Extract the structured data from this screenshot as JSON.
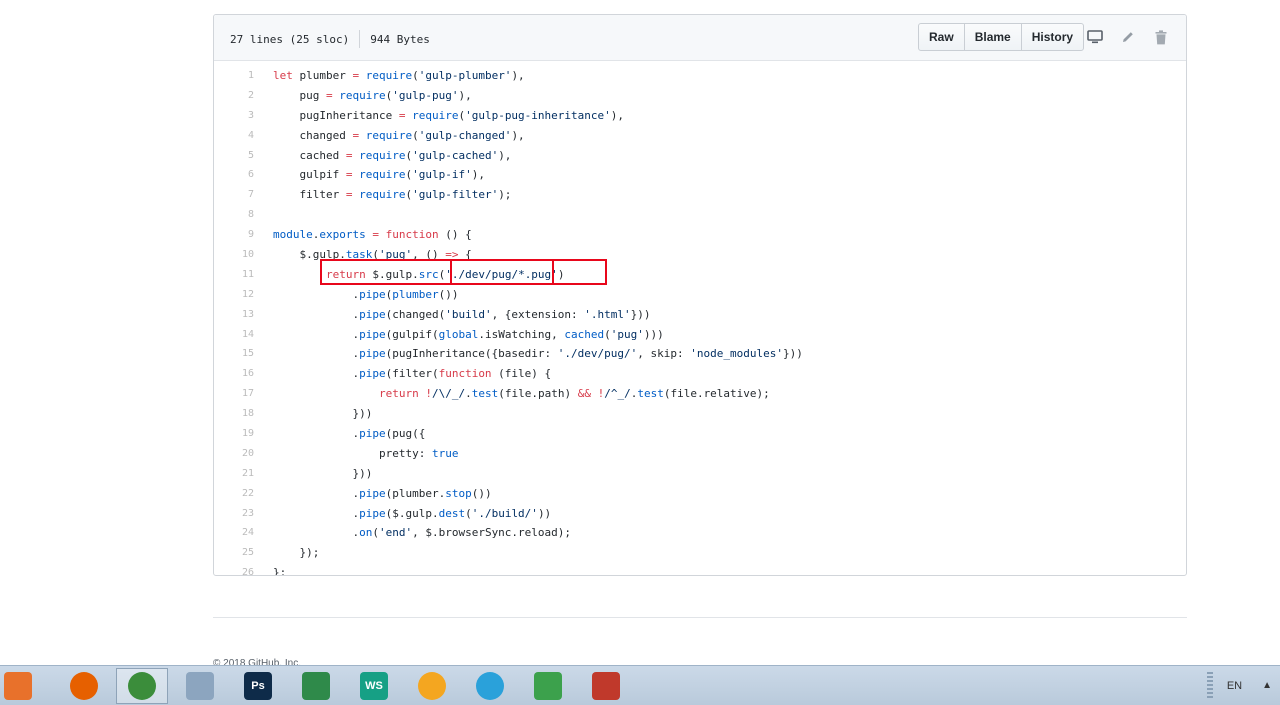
{
  "file_header": {
    "lines_info": "27 lines (25 sloc)",
    "size": "944 Bytes",
    "buttons": [
      "Raw",
      "Blame",
      "History"
    ],
    "icons": [
      "desktop-icon",
      "pencil-icon",
      "trash-icon"
    ]
  },
  "code_lines": [
    {
      "num": "1",
      "parts": [
        {
          "t": "let",
          "c": "kw"
        },
        {
          "t": " plumber "
        },
        {
          "t": "=",
          "c": "kw"
        },
        {
          "t": " "
        },
        {
          "t": "require",
          "c": "fn"
        },
        {
          "t": "("
        },
        {
          "t": "'gulp-plumber'",
          "c": "str"
        },
        {
          "t": "),"
        }
      ]
    },
    {
      "num": "2",
      "parts": [
        {
          "t": "    pug "
        },
        {
          "t": "=",
          "c": "kw"
        },
        {
          "t": " "
        },
        {
          "t": "require",
          "c": "fn"
        },
        {
          "t": "("
        },
        {
          "t": "'gulp-pug'",
          "c": "str"
        },
        {
          "t": "),"
        }
      ]
    },
    {
      "num": "3",
      "parts": [
        {
          "t": "    pugInheritance "
        },
        {
          "t": "=",
          "c": "kw"
        },
        {
          "t": " "
        },
        {
          "t": "require",
          "c": "fn"
        },
        {
          "t": "("
        },
        {
          "t": "'gulp-pug-inheritance'",
          "c": "str"
        },
        {
          "t": "),"
        }
      ]
    },
    {
      "num": "4",
      "parts": [
        {
          "t": "    changed "
        },
        {
          "t": "=",
          "c": "kw"
        },
        {
          "t": " "
        },
        {
          "t": "require",
          "c": "fn"
        },
        {
          "t": "("
        },
        {
          "t": "'gulp-changed'",
          "c": "str"
        },
        {
          "t": "),"
        }
      ]
    },
    {
      "num": "5",
      "parts": [
        {
          "t": "    cached "
        },
        {
          "t": "=",
          "c": "kw"
        },
        {
          "t": " "
        },
        {
          "t": "require",
          "c": "fn"
        },
        {
          "t": "("
        },
        {
          "t": "'gulp-cached'",
          "c": "str"
        },
        {
          "t": "),"
        }
      ]
    },
    {
      "num": "6",
      "parts": [
        {
          "t": "    gulpif "
        },
        {
          "t": "=",
          "c": "kw"
        },
        {
          "t": " "
        },
        {
          "t": "require",
          "c": "fn"
        },
        {
          "t": "("
        },
        {
          "t": "'gulp-if'",
          "c": "str"
        },
        {
          "t": "),"
        }
      ]
    },
    {
      "num": "7",
      "parts": [
        {
          "t": "    filter "
        },
        {
          "t": "=",
          "c": "kw"
        },
        {
          "t": " "
        },
        {
          "t": "require",
          "c": "fn"
        },
        {
          "t": "("
        },
        {
          "t": "'gulp-filter'",
          "c": "str"
        },
        {
          "t": ");"
        }
      ]
    },
    {
      "num": "8",
      "parts": []
    },
    {
      "num": "9",
      "parts": [
        {
          "t": "module",
          "c": "fn"
        },
        {
          "t": "."
        },
        {
          "t": "exports",
          "c": "fn"
        },
        {
          "t": " "
        },
        {
          "t": "=",
          "c": "kw"
        },
        {
          "t": " "
        },
        {
          "t": "function",
          "c": "kw"
        },
        {
          "t": " () {"
        }
      ]
    },
    {
      "num": "10",
      "parts": [
        {
          "t": "    $.gulp."
        },
        {
          "t": "task",
          "c": "fn"
        },
        {
          "t": "("
        },
        {
          "t": "'pug'",
          "c": "str"
        },
        {
          "t": ", () "
        },
        {
          "t": "=>",
          "c": "kw"
        },
        {
          "t": " {"
        }
      ]
    },
    {
      "num": "11",
      "parts": [
        {
          "t": "        "
        },
        {
          "t": "return",
          "c": "kw"
        },
        {
          "t": " $.gulp."
        },
        {
          "t": "src",
          "c": "fn"
        },
        {
          "t": "("
        },
        {
          "t": "'./dev/pug/*.pug'",
          "c": "str"
        },
        {
          "t": ")"
        }
      ]
    },
    {
      "num": "12",
      "parts": [
        {
          "t": "            ."
        },
        {
          "t": "pipe",
          "c": "fn"
        },
        {
          "t": "("
        },
        {
          "t": "plumber",
          "c": "fn"
        },
        {
          "t": "())"
        }
      ]
    },
    {
      "num": "13",
      "parts": [
        {
          "t": "            ."
        },
        {
          "t": "pipe",
          "c": "fn"
        },
        {
          "t": "(changed("
        },
        {
          "t": "'build'",
          "c": "str"
        },
        {
          "t": ", {extension: "
        },
        {
          "t": "'.html'",
          "c": "str"
        },
        {
          "t": "}))"
        }
      ]
    },
    {
      "num": "14",
      "parts": [
        {
          "t": "            ."
        },
        {
          "t": "pipe",
          "c": "fn"
        },
        {
          "t": "(gulpif("
        },
        {
          "t": "global",
          "c": "fn"
        },
        {
          "t": ".isWatching, "
        },
        {
          "t": "cached",
          "c": "fn"
        },
        {
          "t": "("
        },
        {
          "t": "'pug'",
          "c": "str"
        },
        {
          "t": ")))"
        }
      ]
    },
    {
      "num": "15",
      "parts": [
        {
          "t": "            ."
        },
        {
          "t": "pipe",
          "c": "fn"
        },
        {
          "t": "(pugInheritance({basedir: "
        },
        {
          "t": "'./dev/pug/'",
          "c": "str"
        },
        {
          "t": ", skip: "
        },
        {
          "t": "'node_modules'",
          "c": "str"
        },
        {
          "t": "}))"
        }
      ]
    },
    {
      "num": "16",
      "parts": [
        {
          "t": "            ."
        },
        {
          "t": "pipe",
          "c": "fn"
        },
        {
          "t": "(filter("
        },
        {
          "t": "function",
          "c": "kw"
        },
        {
          "t": " (file) {"
        }
      ]
    },
    {
      "num": "17",
      "parts": [
        {
          "t": "                "
        },
        {
          "t": "return",
          "c": "kw"
        },
        {
          "t": " "
        },
        {
          "t": "!",
          "c": "kw"
        },
        {
          "t": "/\\/_/",
          "c": "str"
        },
        {
          "t": "."
        },
        {
          "t": "test",
          "c": "fn"
        },
        {
          "t": "(file.path) "
        },
        {
          "t": "&&",
          "c": "kw"
        },
        {
          "t": " "
        },
        {
          "t": "!",
          "c": "kw"
        },
        {
          "t": "/^_/",
          "c": "str"
        },
        {
          "t": "."
        },
        {
          "t": "test",
          "c": "fn"
        },
        {
          "t": "(file.relative);"
        }
      ]
    },
    {
      "num": "18",
      "parts": [
        {
          "t": "            }))"
        }
      ]
    },
    {
      "num": "19",
      "parts": [
        {
          "t": "            ."
        },
        {
          "t": "pipe",
          "c": "fn"
        },
        {
          "t": "(pug({"
        }
      ]
    },
    {
      "num": "20",
      "parts": [
        {
          "t": "                pretty: "
        },
        {
          "t": "true",
          "c": "fn"
        }
      ]
    },
    {
      "num": "21",
      "parts": [
        {
          "t": "            }))"
        }
      ]
    },
    {
      "num": "22",
      "parts": [
        {
          "t": "            ."
        },
        {
          "t": "pipe",
          "c": "fn"
        },
        {
          "t": "(plumber."
        },
        {
          "t": "stop",
          "c": "fn"
        },
        {
          "t": "())"
        }
      ]
    },
    {
      "num": "23",
      "parts": [
        {
          "t": "            ."
        },
        {
          "t": "pipe",
          "c": "fn"
        },
        {
          "t": "($.gulp."
        },
        {
          "t": "dest",
          "c": "fn"
        },
        {
          "t": "("
        },
        {
          "t": "'./build/'",
          "c": "str"
        },
        {
          "t": "))"
        }
      ]
    },
    {
      "num": "24",
      "parts": [
        {
          "t": "            ."
        },
        {
          "t": "on",
          "c": "fn"
        },
        {
          "t": "("
        },
        {
          "t": "'end'",
          "c": "str"
        },
        {
          "t": ", $.browserSync.reload);"
        }
      ]
    },
    {
      "num": "25",
      "parts": [
        {
          "t": "    });"
        }
      ]
    },
    {
      "num": "26",
      "parts": [
        {
          "t": "};"
        }
      ]
    }
  ],
  "colors": {
    "kw": "#d73a49",
    "fn": "#005cc5",
    "str": "#032f62",
    "plain": "#24292e",
    "highlight": "#e8071b"
  },
  "footer": {
    "copyright": "© 2018 GitHub, Inc."
  },
  "taskbar": {
    "apps": [
      {
        "name": "start-button",
        "label": "",
        "color": "#e8712b"
      },
      {
        "name": "firefox-icon",
        "label": "",
        "color": "#e66000"
      },
      {
        "name": "chrome-icon",
        "label": "",
        "color": "#3b8d3b"
      },
      {
        "name": "calculator-icon",
        "label": "",
        "color": "#8ca5bf"
      },
      {
        "name": "photoshop-icon",
        "label": "Ps",
        "color": "#0e2b49"
      },
      {
        "name": "gplates-icon",
        "label": "",
        "color": "#2f8a4a"
      },
      {
        "name": "webstorm-icon",
        "label": "WS",
        "color": "#16a085"
      },
      {
        "name": "rainbow-app-icon",
        "label": "",
        "color": "#f4a620"
      },
      {
        "name": "telegram-icon",
        "label": "",
        "color": "#2aa1da"
      },
      {
        "name": "spreadsheet-icon",
        "label": "",
        "color": "#3ca14c"
      },
      {
        "name": "doublecommander-icon",
        "label": "",
        "color": "#c0392b"
      }
    ],
    "active_index": 2,
    "language": "EN",
    "tray_chevron": "▲"
  }
}
